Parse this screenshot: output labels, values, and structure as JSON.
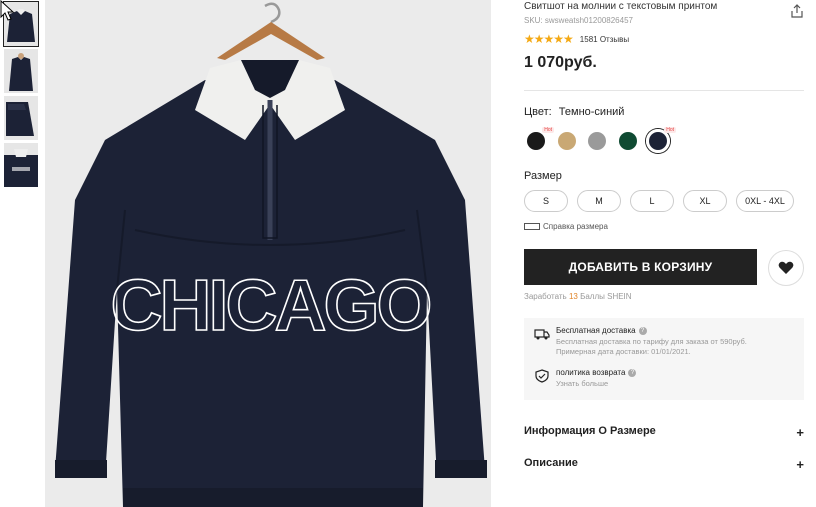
{
  "product": {
    "title": "Свитшот на молнии с текстовым принтом",
    "sku": "SKU: swsweatsh01200826457",
    "stars": "★★★★★",
    "reviews": "1581 Отзывы",
    "price": "1 070руб.",
    "graphic_text": "CHICAGO"
  },
  "color": {
    "label": "Цвет:",
    "value": "Темно-синий",
    "swatches": [
      {
        "hex": "#1a1a1a",
        "hot": "Hot"
      },
      {
        "hex": "#c9a874",
        "hot": ""
      },
      {
        "hex": "#9a9a9a",
        "hot": ""
      },
      {
        "hex": "#0f4a32",
        "hot": ""
      },
      {
        "hex": "#1c2236",
        "hot": "Hot"
      }
    ]
  },
  "size": {
    "label": "Размер",
    "options": [
      "S",
      "M",
      "L",
      "XL",
      "0XL - 4XL"
    ],
    "guide": "Справка размера"
  },
  "actions": {
    "add_to_cart": "ДОБАВИТЬ В КОРЗИНУ",
    "earn_prefix": "Заработать",
    "earn_points": "13",
    "earn_suffix": "Баллы SHEIN"
  },
  "shipping": {
    "free_title": "Бесплатная доставка",
    "free_sub1": "Бесплатная доставка по тарифу для заказа от 590руб.",
    "free_sub2": "Примерная дата доставки: 01/01/2021.",
    "return_title": "политика возврата",
    "return_sub": "Узнать больше",
    "help_glyph": "?"
  },
  "accordion": {
    "size_info": "Информация О Размере",
    "description": "Описание",
    "plus": "+"
  },
  "colors": {
    "accent": "#222222",
    "star": "#f4a914",
    "points": "#e0852a",
    "sweatshirt": "#1c2236"
  }
}
